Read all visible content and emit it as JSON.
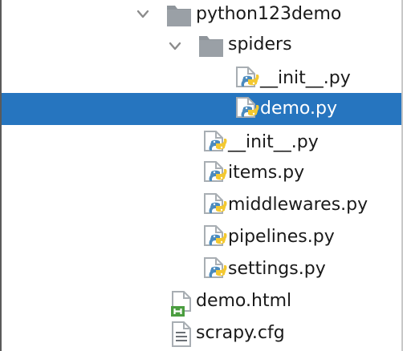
{
  "tree": {
    "project": {
      "label": "python123demo",
      "expand_icon": "chevron-down-icon",
      "icon": "folder-icon"
    },
    "spiders": {
      "label": "spiders",
      "expand_icon": "chevron-down-icon",
      "icon": "folder-icon"
    },
    "spiders_init": {
      "label": "__init__.py",
      "icon": "python-file-icon"
    },
    "demo_py": {
      "label": "demo.py",
      "icon": "python-file-icon",
      "selected": true
    },
    "pkg_init": {
      "label": "__init__.py",
      "icon": "python-file-icon"
    },
    "items": {
      "label": "items.py",
      "icon": "python-file-icon"
    },
    "middlewares": {
      "label": "middlewares.py",
      "icon": "python-file-icon"
    },
    "pipelines": {
      "label": "pipelines.py",
      "icon": "python-file-icon"
    },
    "settings": {
      "label": "settings.py",
      "icon": "python-file-icon"
    },
    "demo_html": {
      "label": "demo.html",
      "icon": "html-file-icon"
    },
    "scrapy_cfg": {
      "label": "scrapy.cfg",
      "icon": "config-file-icon"
    }
  },
  "colors": {
    "selection": "#2675bf",
    "folder": "#8f959b",
    "python_blue": "#4b8bbe",
    "python_yellow": "#f3c830",
    "html_green": "#4a9d3f",
    "file_gray": "#a8aeb3"
  }
}
